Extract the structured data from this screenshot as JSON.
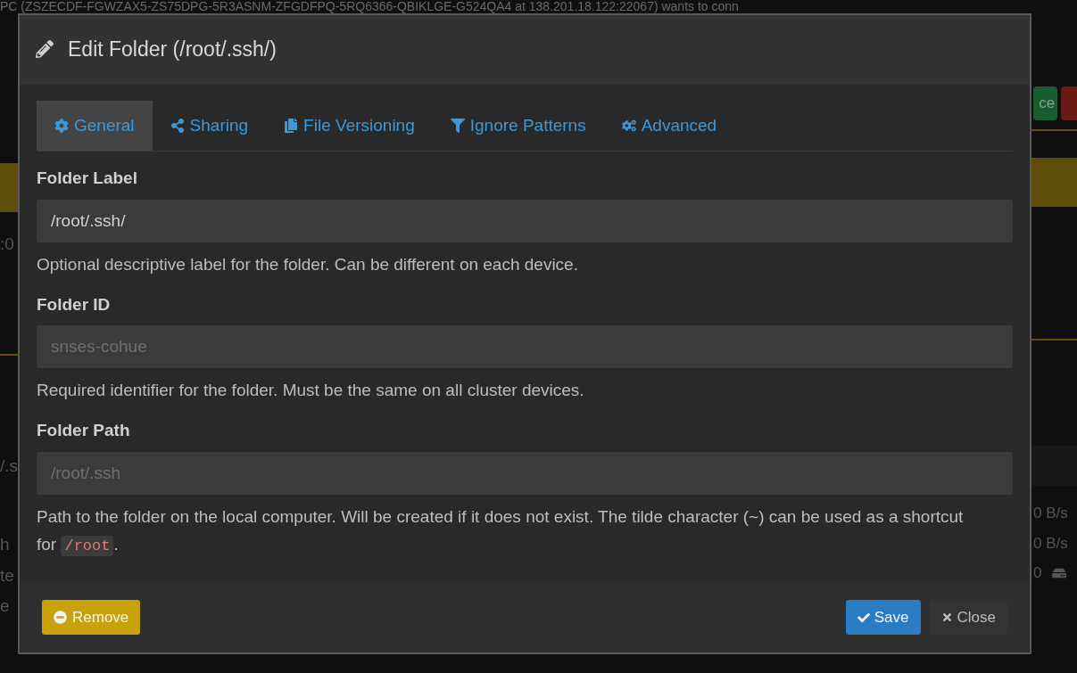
{
  "background": {
    "banner": "PC  (ZSZECDF-FGWZAX5-ZS75DPG-5R3ASNM-ZFGDFPQ-5RQ6366-QBIKLGE-G524QA4 at 138.201.18.122:22067) wants to conn",
    "left_fragments": [
      ":0",
      "/.s",
      "h",
      "te",
      "e"
    ],
    "right_button": "ce",
    "right_stats": [
      "0 B/s",
      "0 B/s",
      "0"
    ]
  },
  "modal": {
    "title": "Edit Folder (/root/.ssh/)",
    "tabs": [
      {
        "label": "General",
        "selected": true
      },
      {
        "label": "Sharing",
        "selected": false
      },
      {
        "label": "File Versioning",
        "selected": false
      },
      {
        "label": "Ignore Patterns",
        "selected": false
      },
      {
        "label": "Advanced",
        "selected": false
      }
    ],
    "fields": [
      {
        "label": "Folder Label",
        "value": "/root/.ssh/",
        "disabled": false,
        "help": "Optional descriptive label for the folder. Can be different on each device."
      },
      {
        "label": "Folder ID",
        "value": "snses-cohue",
        "disabled": true,
        "help": "Required identifier for the folder. Must be the same on all cluster devices."
      },
      {
        "label": "Folder Path",
        "value": "/root/.ssh",
        "disabled": true,
        "help": "Path to the folder on the local computer. Will be created if it does not exist. The tilde character (~) can be used as a shortcut for",
        "help_code": "/root",
        "help_after": "."
      }
    ],
    "buttons": {
      "remove": "Remove",
      "save": "Save",
      "close": "Close"
    }
  }
}
